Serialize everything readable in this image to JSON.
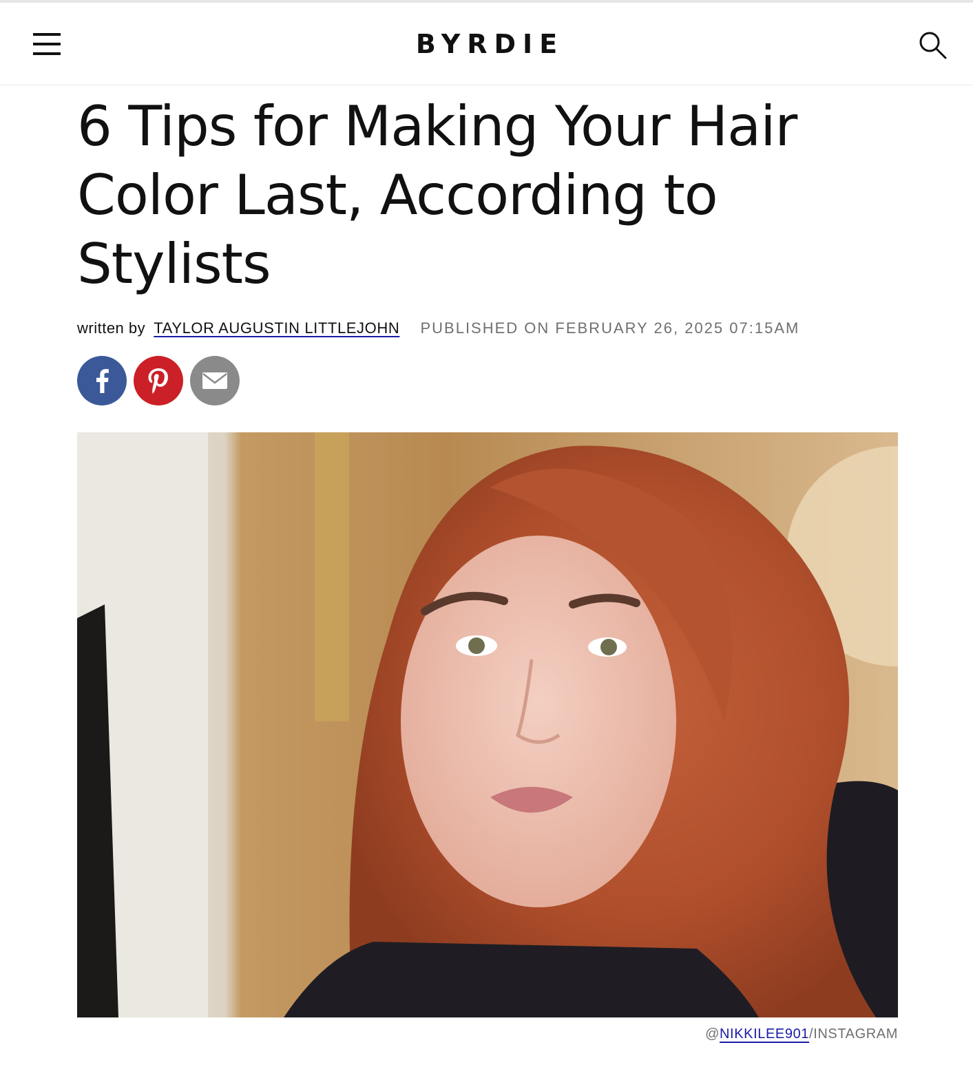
{
  "header": {
    "logo": "BYRDIE",
    "menu_icon": "hamburger-menu-icon",
    "search_icon": "search-icon"
  },
  "article": {
    "title_lines": [
      "6 Tips for Making Your Hair",
      "Color Last, According to",
      "Stylists"
    ],
    "byline": {
      "prefix": "written by",
      "author": "TAYLOR AUGUSTIN LITTLEJOHN",
      "published": "PUBLISHED ON FEBRUARY 26, 2025 07:15AM"
    },
    "share": [
      {
        "name": "facebook",
        "icon": "facebook-icon",
        "color": "#3b5998"
      },
      {
        "name": "pinterest",
        "icon": "pinterest-icon",
        "color": "#cb2027"
      },
      {
        "name": "email",
        "icon": "email-icon",
        "color": "#8a8a8a"
      }
    ],
    "hero_image": {
      "description": "woman-with-copper-red-hair-selfie",
      "caption_prefix": "@",
      "caption_handle": "NIKKILEE901",
      "caption_suffix": "/INSTAGRAM"
    }
  }
}
